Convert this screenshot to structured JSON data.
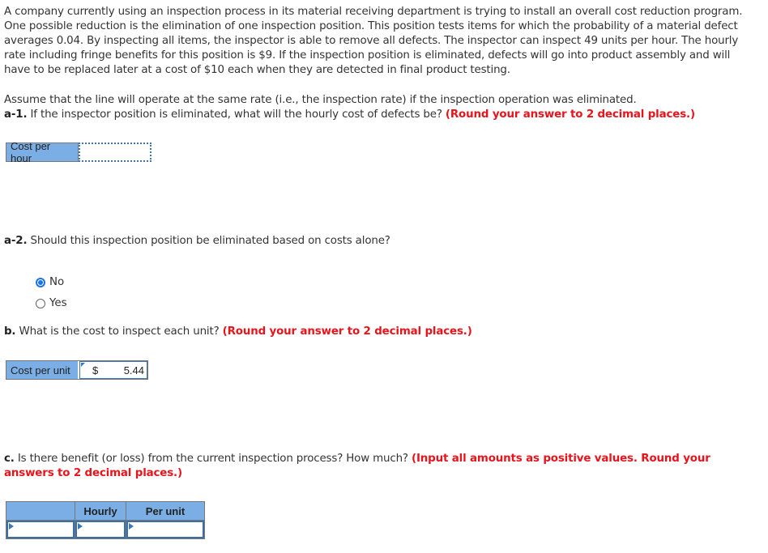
{
  "problem": {
    "intro": "A company currently using an inspection process in its material receiving department is trying to install an overall cost reduction program. One possible reduction is the elimination of one inspection position. This position tests items for which the probability of a material defect averages 0.04. By inspecting all items, the inspector is able to remove all defects. The inspector can inspect 49 units per hour. The hourly rate including fringe benefits for this position is $9. If the inspection position is eliminated, defects will go into product assembly and will have to be replaced later at a cost of $10 each when they are detected in final product testing.",
    "assumption": "Assume that the line will operate at the same rate (i.e., the inspection rate) if the inspection operation was eliminated."
  },
  "a1": {
    "label": "a-1.",
    "question": " If the inspector position is eliminated, what will the hourly cost of defects be? ",
    "instruction": "(Round your answer to 2 decimal places.)",
    "field_label": "Cost per hour",
    "field_value": ""
  },
  "a2": {
    "label": "a-2.",
    "question": " Should this inspection position be eliminated based on costs alone?",
    "options": [
      {
        "label": "No",
        "selected": true
      },
      {
        "label": "Yes",
        "selected": false
      }
    ]
  },
  "b": {
    "label": "b.",
    "question": " What is the cost to inspect each unit? ",
    "instruction": "(Round your answer to 2 decimal places.)",
    "field_label": "Cost per unit",
    "currency": "$",
    "field_value": "5.44"
  },
  "c": {
    "label": "c.",
    "question": " Is there benefit (or loss) from the current inspection process? How much? ",
    "instruction": "(Input all amounts as positive values. Round your answers to 2 decimal places.)",
    "table": {
      "headers": [
        "",
        "Hourly",
        "Per unit"
      ],
      "row": [
        "",
        "",
        ""
      ]
    }
  }
}
